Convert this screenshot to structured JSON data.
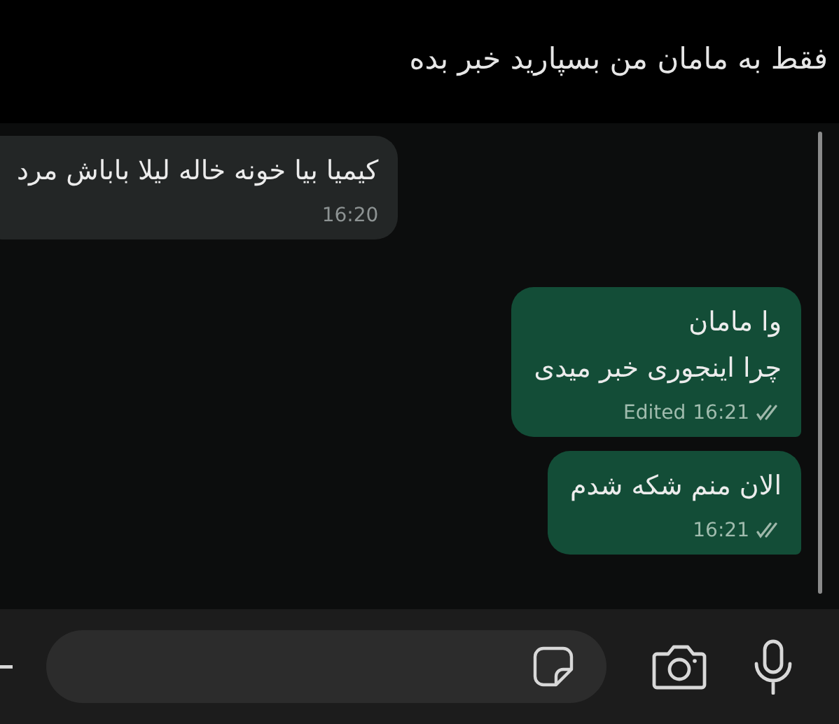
{
  "caption": "فقط به مامان من بسپارید خبر بده",
  "messages": [
    {
      "kind": "incoming",
      "text": "کیمیا بیا خونه خاله لیلا باباش مرد",
      "time": "16:20"
    },
    {
      "kind": "outgoing",
      "text": "وا مامان\nچرا اینجوری خبر میدی",
      "edited": "Edited",
      "time": "16:21",
      "read": false
    },
    {
      "kind": "outgoing",
      "text": "الان منم شکه شدم",
      "time": "16:21",
      "read": false
    }
  ]
}
